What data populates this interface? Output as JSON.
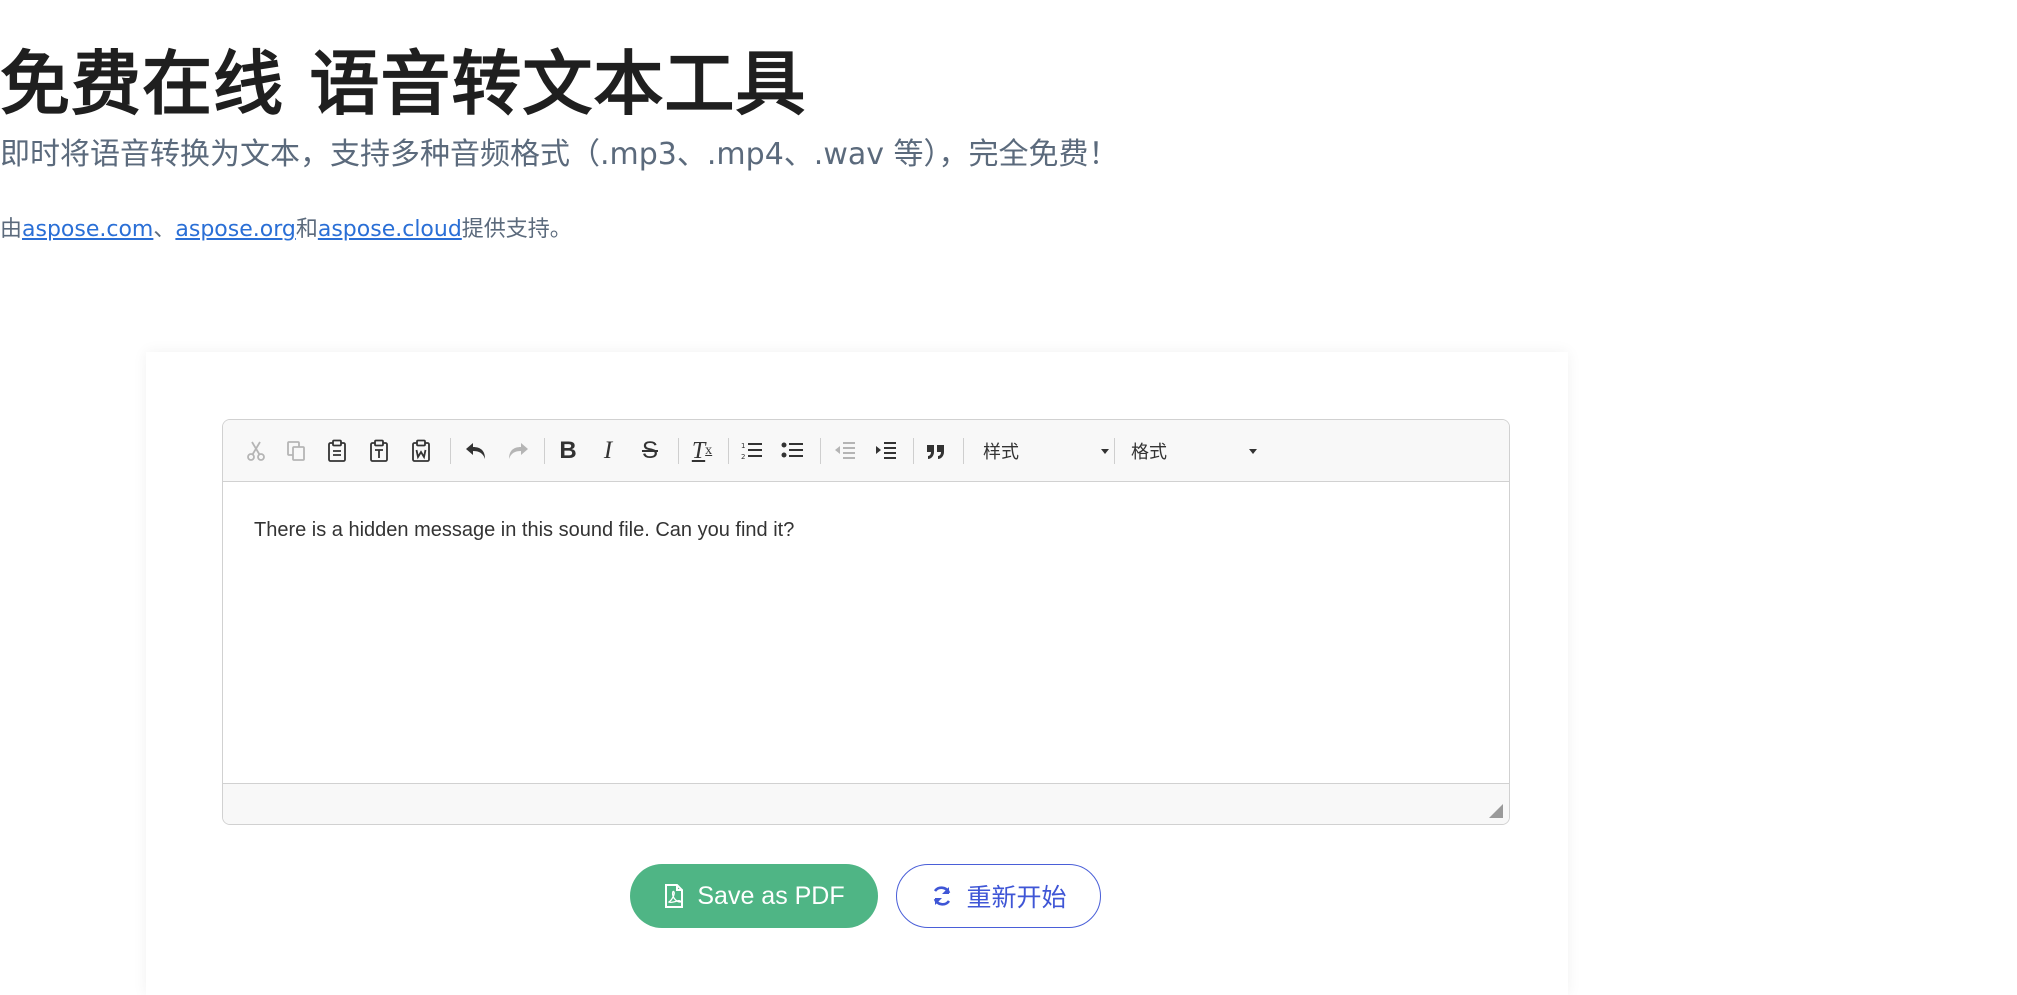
{
  "header": {
    "title": "免费在线 语音转文本工具",
    "subtitle": "即时将语音转换为文本，支持多种音频格式（.mp3、.mp4、.wav 等），完全免费！",
    "powered_prefix": "由",
    "links": [
      "aspose.com",
      "aspose.org",
      "aspose.cloud"
    ],
    "sep1": "、",
    "sep2": "和",
    "powered_suffix": "提供支持。"
  },
  "editor": {
    "toolbar": {
      "styles_label": "样式",
      "format_label": "格式"
    },
    "content_text": "There is a hidden message in this sound file. Can you find it?"
  },
  "actions": {
    "save_pdf_label": "Save as PDF",
    "restart_label": "重新开始"
  },
  "icons": {
    "cut": "cut-icon",
    "copy": "copy-icon",
    "paste": "paste-icon",
    "paste_text": "paste-text-icon",
    "paste_word": "paste-word-icon",
    "undo": "undo-icon",
    "redo": "redo-icon",
    "bold": "bold-icon",
    "italic": "italic-icon",
    "strike": "strikethrough-icon",
    "remove_format": "remove-format-icon",
    "numbered_list": "numbered-list-icon",
    "bulleted_list": "bulleted-list-icon",
    "outdent": "outdent-icon",
    "indent": "indent-icon",
    "blockquote": "blockquote-icon",
    "pdf": "file-pdf-icon",
    "refresh": "refresh-icon"
  },
  "colors": {
    "primary_green": "#4fb585",
    "accent_blue": "#3f56d6",
    "link_blue": "#2a6fd6",
    "subtitle_gray": "#5b6a7c"
  }
}
